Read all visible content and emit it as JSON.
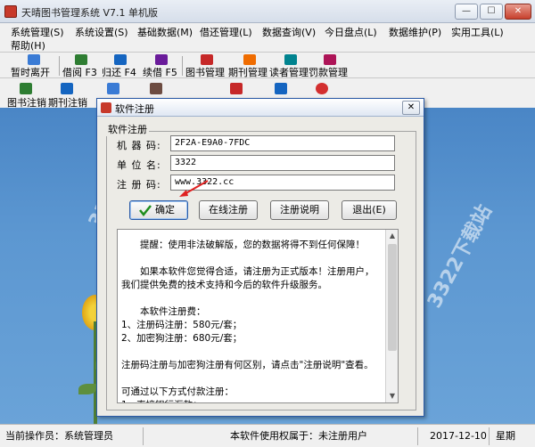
{
  "window": {
    "title": "天晴图书管理系统 V7.1 单机版",
    "min_symbol": "—",
    "max_symbol": "☐",
    "close_symbol": "✕"
  },
  "menu": {
    "items": [
      {
        "label": "系统管理(S)"
      },
      {
        "label": "系统设置(S)"
      },
      {
        "label": "基础数据(M)"
      },
      {
        "label": "借还管理(L)"
      },
      {
        "label": "数据查询(V)"
      },
      {
        "label": "今日盘点(L)"
      },
      {
        "label": "数据维护(P)"
      },
      {
        "label": "实用工具(L)"
      },
      {
        "label": "帮助(H)"
      }
    ]
  },
  "toolbar": {
    "buttons": [
      {
        "label": "暂时离开",
        "icon": "logout-arrow-icon",
        "color": "#3a7bd5"
      },
      {
        "label": "借阅 F3",
        "icon": "borrow-book-icon",
        "color": "#2e7d32"
      },
      {
        "label": "归还 F4",
        "icon": "return-book-icon",
        "color": "#1565c0"
      },
      {
        "label": "续借 F5",
        "icon": "renew-icon",
        "color": "#6a1b9a"
      },
      {
        "label": "图书管理",
        "icon": "book-icon",
        "color": "#c62828"
      },
      {
        "label": "期刊管理",
        "icon": "journal-icon",
        "color": "#ef6c00"
      },
      {
        "label": "读者管理",
        "icon": "reader-icon",
        "color": "#00838f"
      },
      {
        "label": "罚款管理",
        "icon": "fine-icon",
        "color": "#ad1457"
      }
    ]
  },
  "toolbar2": {
    "buttons": [
      {
        "label": "图书注销",
        "icon": "cancel-book-icon",
        "color": "#2e7d32"
      },
      {
        "label": "期刊注销",
        "icon": "cancel-journal-icon",
        "color": "#1565c0"
      }
    ],
    "icons": [
      {
        "icon": "search-icon",
        "color": "#3a7bd5"
      },
      {
        "icon": "report-icon",
        "color": "#6d4c41"
      },
      {
        "icon": "calendar-icon",
        "color": "#c62828"
      },
      {
        "icon": "help-book-icon",
        "color": "#1565c0"
      },
      {
        "icon": "exit-icon",
        "color": "#d32f2f"
      }
    ]
  },
  "dialog": {
    "title": "软件注册",
    "close_symbol": "✕",
    "group_label": "软件注册",
    "fields": {
      "machine_label": "机 器 码:",
      "machine_value": "2F2A-E9A0-7FDC",
      "unit_label": "单 位 名:",
      "unit_value": "3322",
      "reg_label": "注 册 码:",
      "reg_value": "www.3322.cc"
    },
    "buttons": {
      "confirm": "确定",
      "online": "在线注册",
      "info": "注册说明",
      "exit": "退出(E)"
    },
    "notice": "　　提醒：使用非法破解版，您的数据将得不到任何保障！\n\n　　如果本软件您觉得合适，请注册为正式版本！注册用户，我们提供免费的技术支持和今后的软件升级服务。\n\n　　本软件注册费：\n1、注册码注册：580元/套；\n2、加密狗注册：680元/套；\n\n注册码注册与加密狗注册有何区别，请点击\"注册说明\"查看。\n\n可通过以下方式付款注册：\n1、直接银行汇款：\n\n中国建设银行 湖南省怀化市城东支行",
    "scroll_up": "▲",
    "scroll_down": "▼"
  },
  "watermarks": [
    "3322下载站",
    "3322.CC",
    "3322下载站",
    "3322.CC"
  ],
  "status": {
    "operator": "当前操作员：系统管理员",
    "rights": "本软件使用权属于：未注册用户",
    "date": "2017-12-10",
    "weekday": "星期"
  }
}
